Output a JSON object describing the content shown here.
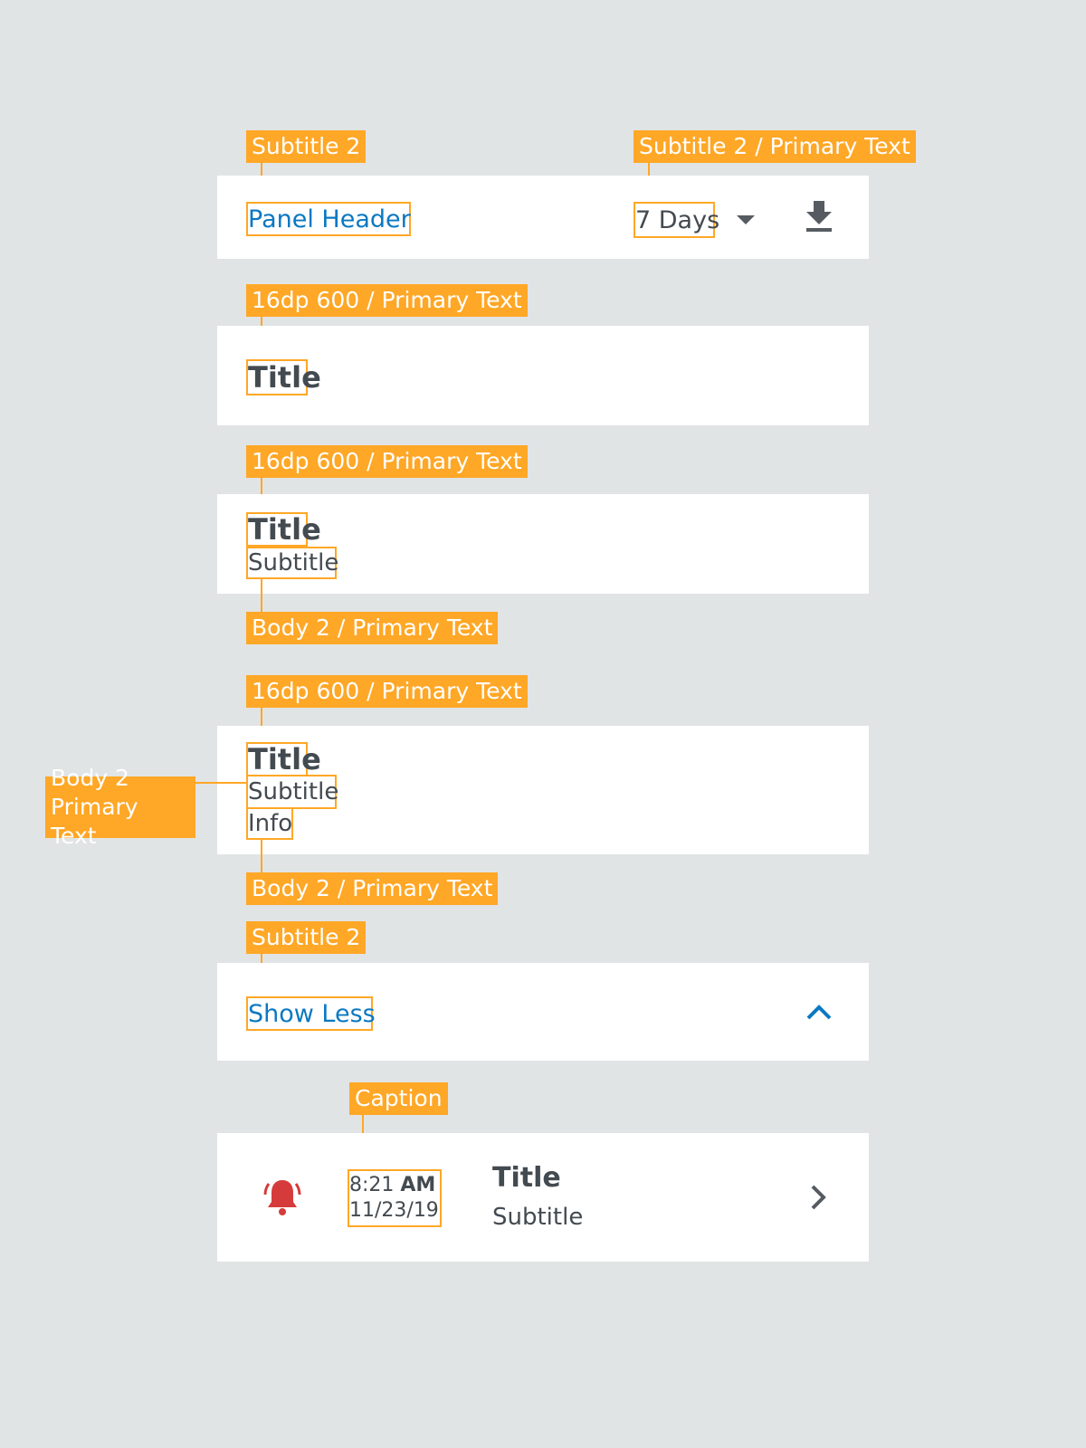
{
  "annotations": {
    "a1": "Subtitle 2",
    "a2": "Subtitle 2 / Primary Text",
    "a3": "16dp 600 / Primary Text",
    "a4": "16dp 600 / Primary Text",
    "a5": "Body 2 / Primary Text",
    "a6": "16dp 600 / Primary Text",
    "a7_line1": "Body 2",
    "a7_line2": "Primary Text",
    "a8": "Body 2 / Primary Text",
    "a9": "Subtitle 2",
    "a10": "Caption"
  },
  "panel_header": {
    "title": "Panel Header",
    "range_value": "7 Days",
    "icons": [
      "dropdown-arrow-icon",
      "download-icon"
    ]
  },
  "card_title": {
    "title": "Title"
  },
  "card_title_subtitle": {
    "title": "Title",
    "subtitle": "Subtitle"
  },
  "card_title_subtitle_info": {
    "title": "Title",
    "subtitle": "Subtitle",
    "info": "Info"
  },
  "show_less": {
    "label": "Show Less",
    "icon": "chevron-up-icon"
  },
  "alert_row": {
    "time": "8:21",
    "meridiem": "AM",
    "date": "11/23/19",
    "title": "Title",
    "subtitle": "Subtitle",
    "icons": [
      "bell-alarm-icon",
      "chevron-right-icon"
    ]
  },
  "colors": {
    "background": "#e1e4e5",
    "card": "#ffffff",
    "annotation": "#ffa726",
    "primary_text": "#434a50",
    "link": "#0b78c2",
    "alert": "#d63b3b"
  }
}
